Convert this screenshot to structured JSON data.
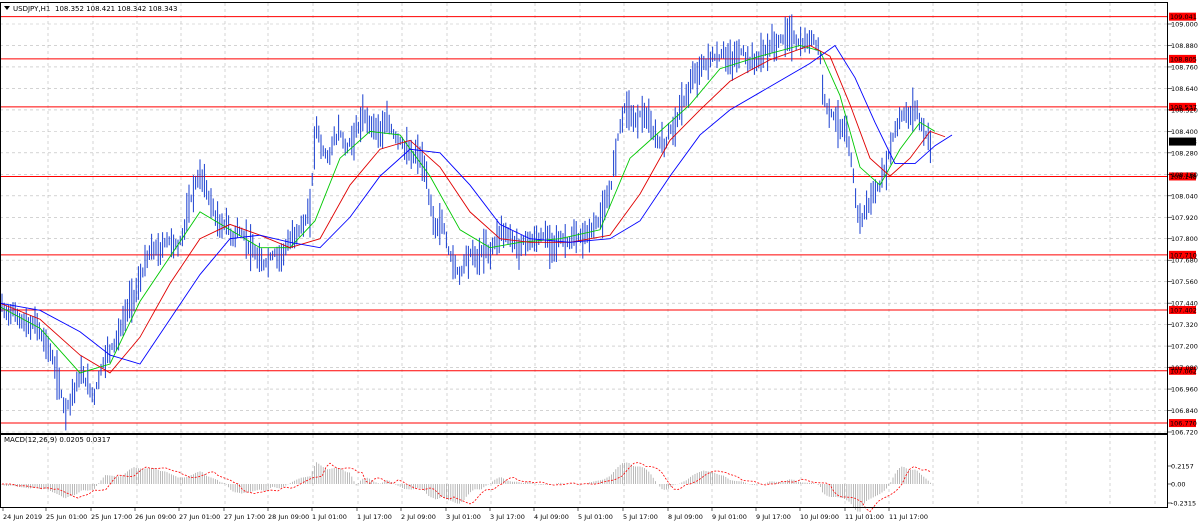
{
  "header": {
    "symbol": "USDJPY,H1",
    "ohlc": "108.352 108.421 108.342 108.343",
    "menu_icon": "triangle-down-icon"
  },
  "colors": {
    "candle": "#1a3fd0",
    "ma_fast": "#00c800",
    "ma_mid": "#e00000",
    "ma_slow": "#0000ff",
    "level_line": "#ff0000",
    "macd_signal": "#ff0000",
    "macd_hist": "#a8a8a8",
    "grid": "#b9b9b9"
  },
  "chart_data": {
    "type": "line",
    "title": "USDJPY,H1",
    "price_axis": {
      "ticks": [
        "109.000",
        "108.880",
        "108.760",
        "108.640",
        "108.520",
        "108.400",
        "108.280",
        "108.160",
        "108.040",
        "107.920",
        "107.800",
        "107.680",
        "107.560",
        "107.440",
        "107.320",
        "107.200",
        "107.080",
        "106.960",
        "106.840",
        "106.720"
      ],
      "ylim": [
        106.69,
        109.04
      ],
      "current_price": "108.343"
    },
    "levels": [
      "109.041",
      "108.805",
      "108.537",
      "108.148",
      "107.710",
      "107.402",
      "107.062",
      "106.770"
    ],
    "x_labels": [
      "24 Jun 2019",
      "25 Jun 01:00",
      "25 Jun 17:00",
      "26 Jun 09:00",
      "27 Jun 01:00",
      "27 Jun 17:00",
      "28 Jun 09:00",
      "1 Jul 01:00",
      "1 Jul 17:00",
      "2 Jul 09:00",
      "3 Jul 01:00",
      "3 Jul 17:00",
      "4 Jul 09:00",
      "5 Jul 01:00",
      "5 Jul 17:00",
      "8 Jul 09:00",
      "9 Jul 01:00",
      "9 Jul 17:00",
      "10 Jul 09:00",
      "11 Jul 01:00",
      "11 Jul 17:00"
    ],
    "price_path": [
      [
        0,
        107.45
      ],
      [
        6,
        107.38
      ],
      [
        12,
        107.4
      ],
      [
        18,
        107.36
      ],
      [
        24,
        107.33
      ],
      [
        30,
        107.3
      ],
      [
        36,
        107.34
      ],
      [
        42,
        107.25
      ],
      [
        48,
        107.2
      ],
      [
        54,
        107.1
      ],
      [
        60,
        106.97
      ],
      [
        65,
        106.84
      ],
      [
        70,
        106.9
      ],
      [
        76,
        106.98
      ],
      [
        82,
        107.05
      ],
      [
        88,
        106.98
      ],
      [
        94,
        106.92
      ],
      [
        100,
        107.05
      ],
      [
        106,
        107.15
      ],
      [
        112,
        107.2
      ],
      [
        118,
        107.25
      ],
      [
        124,
        107.35
      ],
      [
        130,
        107.45
      ],
      [
        136,
        107.5
      ],
      [
        142,
        107.6
      ],
      [
        148,
        107.7
      ],
      [
        154,
        107.75
      ],
      [
        160,
        107.72
      ],
      [
        166,
        107.8
      ],
      [
        172,
        107.78
      ],
      [
        178,
        107.75
      ],
      [
        184,
        107.85
      ],
      [
        190,
        108.0
      ],
      [
        196,
        108.12
      ],
      [
        202,
        108.15
      ],
      [
        208,
        108.05
      ],
      [
        214,
        107.95
      ],
      [
        220,
        107.85
      ],
      [
        226,
        107.9
      ],
      [
        232,
        107.8
      ],
      [
        238,
        107.85
      ],
      [
        244,
        107.82
      ],
      [
        250,
        107.75
      ],
      [
        256,
        107.7
      ],
      [
        262,
        107.65
      ],
      [
        268,
        107.68
      ],
      [
        274,
        107.72
      ],
      [
        280,
        107.7
      ],
      [
        286,
        107.75
      ],
      [
        292,
        107.8
      ],
      [
        298,
        107.85
      ],
      [
        304,
        107.88
      ],
      [
        310,
        107.95
      ],
      [
        316,
        108.45
      ],
      [
        322,
        108.3
      ],
      [
        328,
        108.25
      ],
      [
        334,
        108.35
      ],
      [
        340,
        108.4
      ],
      [
        346,
        108.3
      ],
      [
        352,
        108.35
      ],
      [
        358,
        108.42
      ],
      [
        364,
        108.48
      ],
      [
        370,
        108.45
      ],
      [
        376,
        108.42
      ],
      [
        382,
        108.4
      ],
      [
        388,
        108.45
      ],
      [
        394,
        108.38
      ],
      [
        400,
        108.35
      ],
      [
        406,
        108.3
      ],
      [
        412,
        108.25
      ],
      [
        418,
        108.28
      ],
      [
        424,
        108.2
      ],
      [
        430,
        108.0
      ],
      [
        436,
        107.85
      ],
      [
        442,
        107.9
      ],
      [
        448,
        107.75
      ],
      [
        454,
        107.65
      ],
      [
        460,
        107.6
      ],
      [
        466,
        107.7
      ],
      [
        472,
        107.72
      ],
      [
        478,
        107.68
      ],
      [
        484,
        107.75
      ],
      [
        490,
        107.72
      ],
      [
        496,
        107.8
      ],
      [
        502,
        107.85
      ],
      [
        508,
        107.82
      ],
      [
        514,
        107.78
      ],
      [
        520,
        107.75
      ],
      [
        526,
        107.8
      ],
      [
        532,
        107.78
      ],
      [
        538,
        107.8
      ],
      [
        544,
        107.82
      ],
      [
        550,
        107.78
      ],
      [
        556,
        107.78
      ],
      [
        562,
        107.8
      ],
      [
        568,
        107.78
      ],
      [
        574,
        107.8
      ],
      [
        580,
        107.8
      ],
      [
        586,
        107.82
      ],
      [
        592,
        107.85
      ],
      [
        598,
        107.9
      ],
      [
        604,
        107.95
      ],
      [
        610,
        108.05
      ],
      [
        616,
        108.3
      ],
      [
        622,
        108.5
      ],
      [
        628,
        108.55
      ],
      [
        634,
        108.45
      ],
      [
        640,
        108.5
      ],
      [
        646,
        108.48
      ],
      [
        652,
        108.4
      ],
      [
        658,
        108.35
      ],
      [
        664,
        108.32
      ],
      [
        670,
        108.4
      ],
      [
        676,
        108.45
      ],
      [
        682,
        108.55
      ],
      [
        688,
        108.62
      ],
      [
        694,
        108.7
      ],
      [
        700,
        108.75
      ],
      [
        706,
        108.78
      ],
      [
        712,
        108.82
      ],
      [
        718,
        108.8
      ],
      [
        724,
        108.85
      ],
      [
        730,
        108.78
      ],
      [
        736,
        108.82
      ],
      [
        742,
        108.85
      ],
      [
        748,
        108.8
      ],
      [
        754,
        108.78
      ],
      [
        760,
        108.82
      ],
      [
        766,
        108.85
      ],
      [
        772,
        108.88
      ],
      [
        778,
        108.9
      ],
      [
        784,
        108.92
      ],
      [
        790,
        108.95
      ],
      [
        796,
        108.9
      ],
      [
        802,
        108.88
      ],
      [
        808,
        108.9
      ],
      [
        814,
        108.92
      ],
      [
        820,
        108.85
      ],
      [
        822,
        108.65
      ],
      [
        826,
        108.55
      ],
      [
        832,
        108.5
      ],
      [
        838,
        108.45
      ],
      [
        844,
        108.4
      ],
      [
        850,
        108.3
      ],
      [
        854,
        108.1
      ],
      [
        858,
        107.95
      ],
      [
        862,
        107.9
      ],
      [
        868,
        108.0
      ],
      [
        874,
        108.05
      ],
      [
        880,
        108.1
      ],
      [
        886,
        108.2
      ],
      [
        892,
        108.35
      ],
      [
        898,
        108.45
      ],
      [
        904,
        108.5
      ],
      [
        910,
        108.48
      ],
      [
        916,
        108.55
      ],
      [
        920,
        108.45
      ],
      [
        926,
        108.38
      ],
      [
        932,
        108.34
      ]
    ],
    "series": [
      {
        "periods": "fast",
        "values": [
          [
            0,
            107.42
          ],
          [
            40,
            107.3
          ],
          [
            80,
            107.05
          ],
          [
            110,
            107.1
          ],
          [
            140,
            107.45
          ],
          [
            170,
            107.7
          ],
          [
            200,
            107.95
          ],
          [
            230,
            107.85
          ],
          [
            260,
            107.75
          ],
          [
            290,
            107.75
          ],
          [
            315,
            107.9
          ],
          [
            340,
            108.25
          ],
          [
            370,
            108.4
          ],
          [
            400,
            108.38
          ],
          [
            430,
            108.15
          ],
          [
            460,
            107.85
          ],
          [
            490,
            107.75
          ],
          [
            520,
            107.78
          ],
          [
            560,
            107.8
          ],
          [
            600,
            107.85
          ],
          [
            630,
            108.25
          ],
          [
            660,
            108.4
          ],
          [
            690,
            108.55
          ],
          [
            720,
            108.75
          ],
          [
            760,
            108.82
          ],
          [
            800,
            108.88
          ],
          [
            820,
            108.85
          ],
          [
            840,
            108.6
          ],
          [
            860,
            108.2
          ],
          [
            880,
            108.1
          ],
          [
            900,
            108.3
          ],
          [
            920,
            108.45
          ],
          [
            935,
            108.4
          ]
        ]
      },
      {
        "periods": "mid",
        "values": [
          [
            0,
            107.44
          ],
          [
            40,
            107.35
          ],
          [
            80,
            107.15
          ],
          [
            110,
            107.05
          ],
          [
            140,
            107.25
          ],
          [
            170,
            107.55
          ],
          [
            200,
            107.8
          ],
          [
            230,
            107.88
          ],
          [
            260,
            107.82
          ],
          [
            290,
            107.75
          ],
          [
            320,
            107.8
          ],
          [
            350,
            108.1
          ],
          [
            380,
            108.3
          ],
          [
            410,
            108.35
          ],
          [
            440,
            108.2
          ],
          [
            470,
            107.95
          ],
          [
            500,
            107.8
          ],
          [
            530,
            107.78
          ],
          [
            570,
            107.78
          ],
          [
            610,
            107.82
          ],
          [
            640,
            108.05
          ],
          [
            670,
            108.35
          ],
          [
            700,
            108.52
          ],
          [
            730,
            108.68
          ],
          [
            770,
            108.8
          ],
          [
            810,
            108.88
          ],
          [
            830,
            108.82
          ],
          [
            850,
            108.55
          ],
          [
            870,
            108.25
          ],
          [
            890,
            108.15
          ],
          [
            910,
            108.25
          ],
          [
            930,
            108.4
          ],
          [
            945,
            108.37
          ]
        ]
      },
      {
        "periods": "slow",
        "values": [
          [
            0,
            107.44
          ],
          [
            40,
            107.4
          ],
          [
            80,
            107.28
          ],
          [
            110,
            107.15
          ],
          [
            140,
            107.1
          ],
          [
            170,
            107.35
          ],
          [
            200,
            107.6
          ],
          [
            230,
            107.8
          ],
          [
            260,
            107.82
          ],
          [
            290,
            107.78
          ],
          [
            320,
            107.75
          ],
          [
            350,
            107.92
          ],
          [
            380,
            108.15
          ],
          [
            410,
            108.3
          ],
          [
            440,
            108.28
          ],
          [
            470,
            108.1
          ],
          [
            500,
            107.88
          ],
          [
            530,
            107.8
          ],
          [
            570,
            107.78
          ],
          [
            610,
            107.8
          ],
          [
            640,
            107.9
          ],
          [
            670,
            108.15
          ],
          [
            700,
            108.38
          ],
          [
            730,
            108.52
          ],
          [
            770,
            108.65
          ],
          [
            810,
            108.78
          ],
          [
            835,
            108.88
          ],
          [
            855,
            108.7
          ],
          [
            875,
            108.45
          ],
          [
            895,
            108.22
          ],
          [
            915,
            108.22
          ],
          [
            935,
            108.32
          ],
          [
            952,
            108.38
          ]
        ]
      }
    ],
    "macd": {
      "label": "MACD(12,26,9) 0.0205 0.0317",
      "ticks": [
        "0.2157",
        "0.00",
        "-0.2315"
      ]
    }
  }
}
